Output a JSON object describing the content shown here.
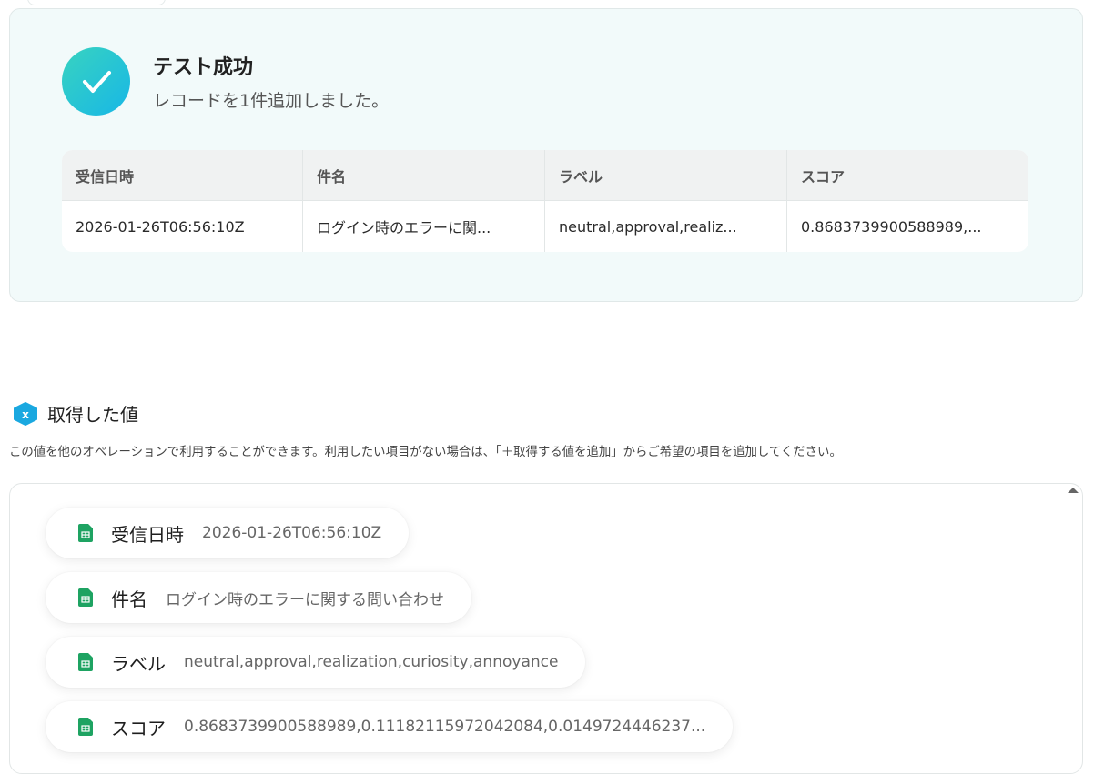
{
  "result": {
    "title": "テスト成功",
    "message": "レコードを1件追加しました。",
    "table": {
      "headers": [
        "受信日時",
        "件名",
        "ラベル",
        "スコア"
      ],
      "row": [
        "2026-01-26T06:56:10Z",
        "ログイン時のエラーに関...",
        "neutral,approval,realiz...",
        "0.8683739900588989,..."
      ]
    },
    "accent_colors": [
      "#38d3c0",
      "#18b7e6"
    ]
  },
  "values_section": {
    "title": "取得した値",
    "description": "この値を他のオペレーションで利用することができます。利用したい項目がない場合は、「＋取得する値を追加」からご希望の項目を追加してください。",
    "items": [
      {
        "label": "受信日時",
        "value": "2026-01-26T06:56:10Z",
        "icon": "sheet-icon"
      },
      {
        "label": "件名",
        "value": "ログイン時のエラーに関する問い合わせ",
        "icon": "sheet-icon"
      },
      {
        "label": "ラベル",
        "value": "neutral,approval,realization,curiosity,annoyance",
        "icon": "sheet-icon"
      },
      {
        "label": "スコア",
        "value": "0.8683739900588989,0.11182115972042084,0.0149724446237...",
        "icon": "sheet-icon"
      }
    ],
    "icon_color": "#1ea362"
  }
}
